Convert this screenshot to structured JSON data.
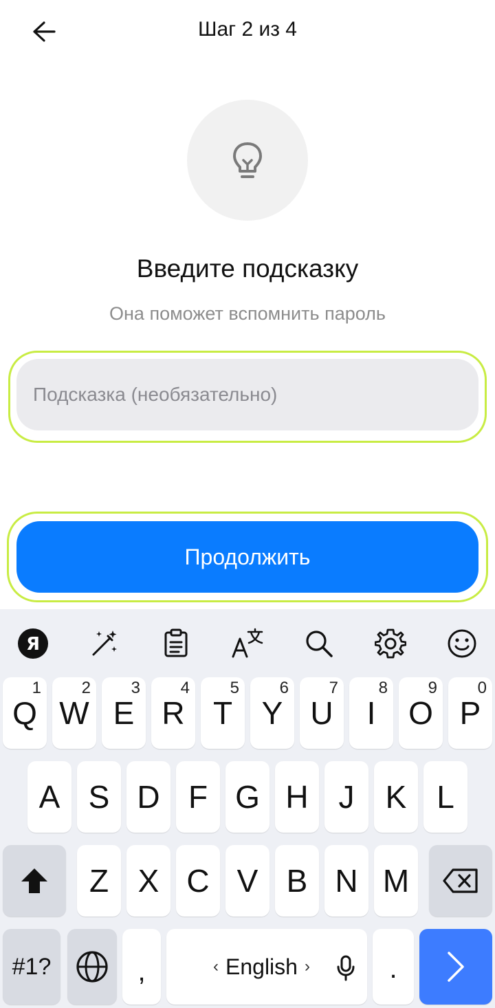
{
  "header": {
    "title": "Шаг 2 из 4",
    "back_icon": "arrow-left-icon"
  },
  "hero": {
    "icon": "lightbulb-icon"
  },
  "main": {
    "title": "Введите подсказку",
    "subtitle": "Она поможет вспомнить пароль",
    "hint_input": {
      "placeholder": "Подсказка (необязательно)",
      "value": ""
    },
    "continue_label": "Продолжить",
    "highlight_color": "#c8ec43",
    "accent_color": "#0a7cff"
  },
  "keyboard": {
    "toolbar": [
      "yandex-logo-icon",
      "magic-wand-icon",
      "clipboard-icon",
      "translate-icon",
      "search-icon",
      "gear-icon",
      "emoji-icon"
    ],
    "toolbar_logo_letter": "Я",
    "row1": [
      {
        "char": "Q",
        "num": "1"
      },
      {
        "char": "W",
        "num": "2"
      },
      {
        "char": "E",
        "num": "3"
      },
      {
        "char": "R",
        "num": "4"
      },
      {
        "char": "T",
        "num": "5"
      },
      {
        "char": "Y",
        "num": "6"
      },
      {
        "char": "U",
        "num": "7"
      },
      {
        "char": "I",
        "num": "8"
      },
      {
        "char": "O",
        "num": "9"
      },
      {
        "char": "P",
        "num": "0"
      }
    ],
    "row2": [
      "A",
      "S",
      "D",
      "F",
      "G",
      "H",
      "J",
      "K",
      "L"
    ],
    "row3": [
      "Z",
      "X",
      "C",
      "V",
      "B",
      "N",
      "M"
    ],
    "symbols_label": "#1?",
    "comma": ",",
    "period": ".",
    "space_label": "English",
    "space_left": "‹",
    "space_right": "›",
    "enter_icon": "chevron-right-icon",
    "shift_icon": "shift-icon",
    "backspace_icon": "backspace-icon",
    "globe_icon": "globe-icon",
    "mic_icon": "microphone-icon"
  }
}
